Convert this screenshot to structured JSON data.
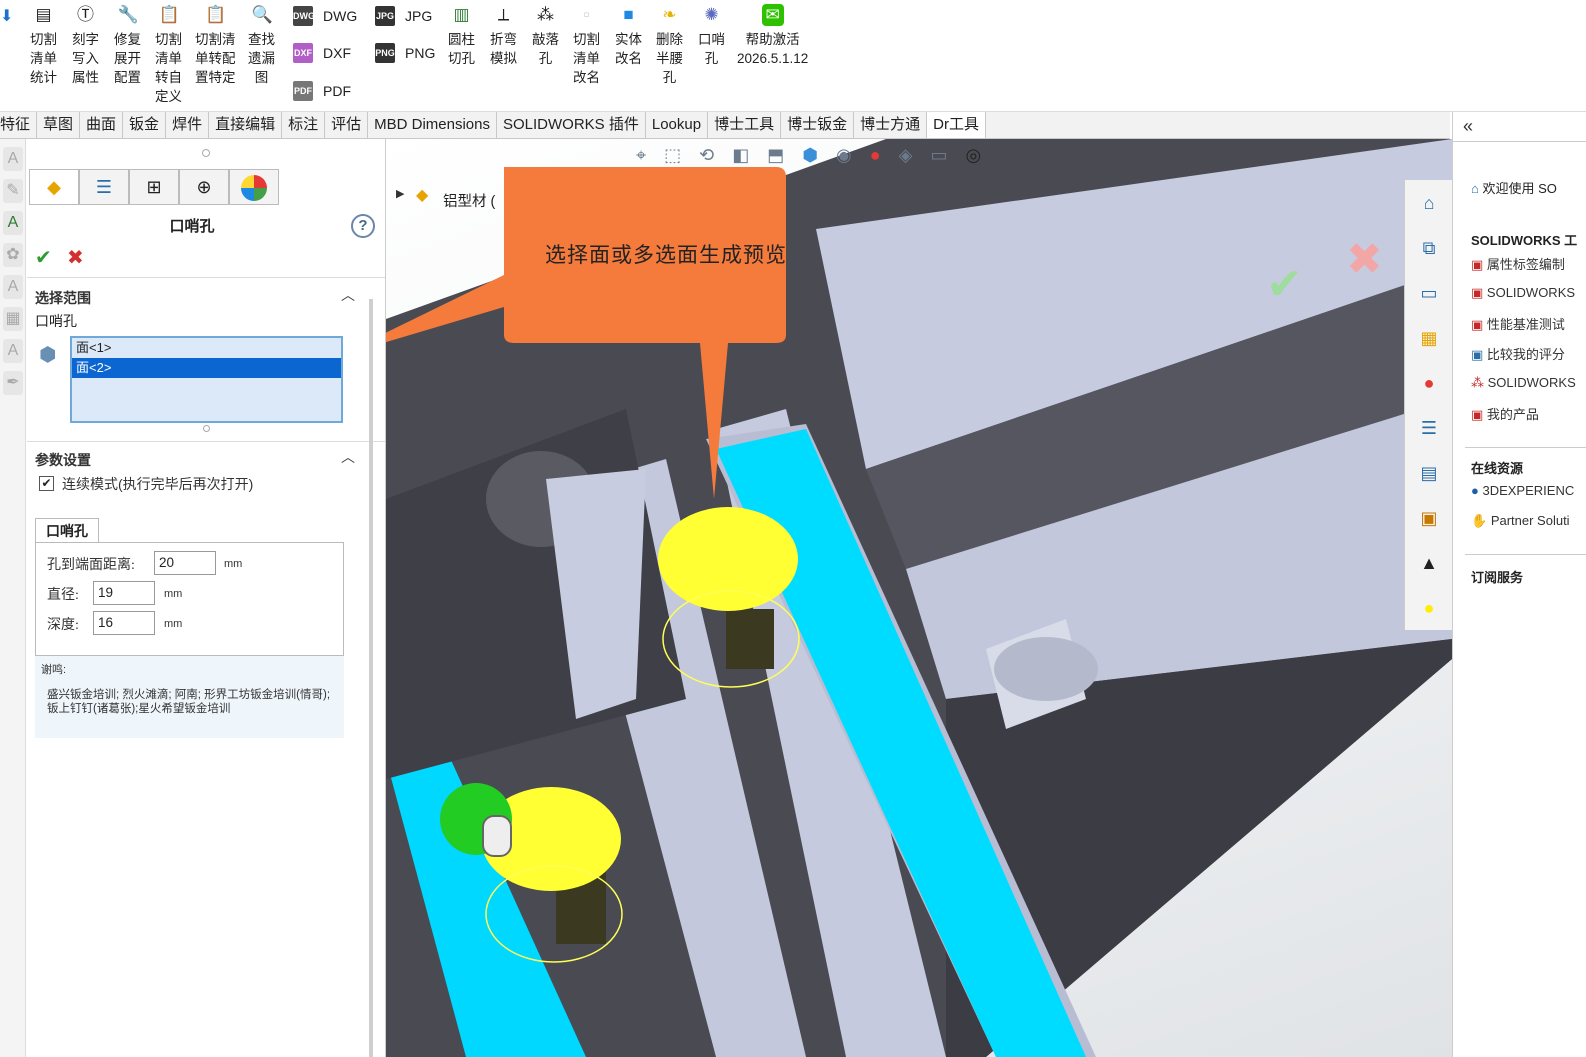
{
  "ribbon": {
    "buttons": [
      {
        "label": "切割\n清单\n统计",
        "icon": "list-icon",
        "color": "#333"
      },
      {
        "label": "刻字\n写入\n属性",
        "icon": "engrave-icon",
        "color": "#333"
      },
      {
        "label": "修复\n展开\n配置",
        "icon": "wrench-icon",
        "color": "#333"
      },
      {
        "label": "切割\n清单\n转自\n定义",
        "icon": "clipboard-icon",
        "color": "#1a73c8"
      },
      {
        "label": "切割清\n单转配\n置特定",
        "icon": "clipboard-pink-icon",
        "color": "#c2185b"
      },
      {
        "label": "查找\n遗漏\n图",
        "icon": "search-icon",
        "color": "#333"
      },
      {
        "label": "圆柱\n切孔",
        "icon": "chart-icon",
        "color": "#2e7d32"
      },
      {
        "label": "折弯\n模拟",
        "icon": "bend-icon",
        "color": "#333"
      },
      {
        "label": "敲落\n孔",
        "icon": "knockout-icon",
        "color": "#333"
      },
      {
        "label": "切割\n清单\n改名",
        "icon": "blank-icon",
        "color": "#ccc"
      },
      {
        "label": "实体\n改名",
        "icon": "cube-icon",
        "color": "#1e88e5"
      },
      {
        "label": "删除\n半腰\n孔",
        "icon": "leaf-icon",
        "color": "#e6b400"
      },
      {
        "label": "口哨\n孔",
        "icon": "whistle-icon",
        "color": "#5c6bc0"
      },
      {
        "label": "帮助激活\n2026.5.1.12",
        "icon": "wechat-icon",
        "color": "#2dc100"
      }
    ],
    "exports": [
      {
        "label": "DWG",
        "badge": "DWG",
        "color": "#444"
      },
      {
        "label": "DXF",
        "badge": "DXF",
        "color": "#b25ec7"
      },
      {
        "label": "PDF",
        "badge": "PDF",
        "color": "#666"
      },
      {
        "label": "JPG",
        "badge": "JPG",
        "color": "#333"
      },
      {
        "label": "PNG",
        "badge": "PNG",
        "color": "#333"
      }
    ]
  },
  "tabs": [
    "特征",
    "草图",
    "曲面",
    "钣金",
    "焊件",
    "直接编辑",
    "标注",
    "评估",
    "MBD Dimensions",
    "SOLIDWORKS 插件",
    "Lookup",
    "博士工具",
    "博士钣金",
    "博士方通",
    "Dr工具"
  ],
  "pm": {
    "title": "口哨孔",
    "help": "?",
    "section_select": "选择范围",
    "select_label": "口哨孔",
    "faces": [
      "面<1>",
      "面<2>"
    ],
    "section_params": "参数设置",
    "checkbox_label": "连续模式(执行完毕后再次打开)",
    "group_tab": "口哨孔",
    "fields": [
      {
        "label": "孔到端面距离:",
        "value": "20",
        "unit": "mm"
      },
      {
        "label": "直径:",
        "value": "19",
        "unit": "mm"
      },
      {
        "label": "深度:",
        "value": "16",
        "unit": "mm"
      }
    ],
    "thanks_title": "谢鸣:",
    "thanks_text": "盛兴钣金培训; 烈火滩滴; 阿南; 形界工坊钣金培训(情哥);钣上钉钉(诸葛张);星火希望钣金培训"
  },
  "tree": {
    "root": "铝型材 ("
  },
  "callout": {
    "text": "选择面或多选面生成预览",
    "color": "#f47b3c"
  },
  "right_panel": {
    "welcome": "欢迎使用 SO",
    "heading1": "SOLIDWORKS 工",
    "items1": [
      "属性标签编制",
      "SOLIDWORKS",
      "性能基准测试",
      "比较我的评分",
      "SOLIDWORKS",
      "我的产品"
    ],
    "heading2": "在线资源",
    "items2": [
      "3DEXPERIENC",
      "Partner Soluti"
    ],
    "heading3": "订阅服务",
    "collapse": "«"
  }
}
